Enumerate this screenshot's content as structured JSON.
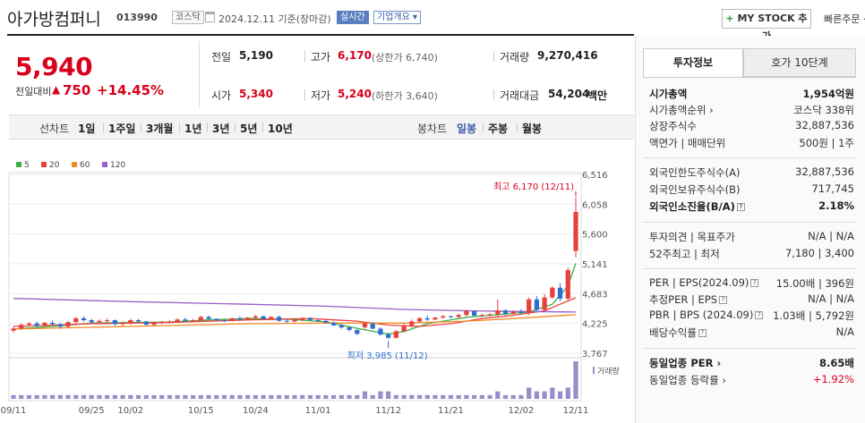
{
  "header": {
    "company_name": "아가방컴퍼니",
    "code": "013990",
    "market_tag": "코스닥",
    "date": "2024.12.11 기준(장마감)",
    "live_tag": "실시간",
    "info_tag": "기업개요 ▾",
    "mystock_label": "MY STOCK 추가",
    "mystock_plus": "+",
    "quick_order": "빠른주문 ·"
  },
  "quote": {
    "price": "5,940",
    "change_label": "전일대비",
    "change_arrow": "▲",
    "change_amount": "750",
    "change_pct": "+14.45%",
    "prev_label": "전일",
    "prev_value": "5,190",
    "high_label": "고가",
    "high_value": "6,170",
    "upper_limit": "(상한가 6,740)",
    "volume_label": "거래량",
    "volume_value": "9,270,416",
    "open_label": "시가",
    "open_value": "5,340",
    "low_label": "저가",
    "low_value": "5,240",
    "lower_limit": "(하한가 3,640)",
    "amount_label": "거래대금",
    "amount_value": "54,204",
    "amount_unit": "백만"
  },
  "period_bar": {
    "line_label": "선차트",
    "line_items": [
      "1일",
      "1주일",
      "3개월",
      "1년",
      "3년",
      "5년",
      "10년"
    ],
    "candle_label": "봉차트",
    "candle_items": [
      "일봉",
      "주봉",
      "월봉"
    ],
    "selected_candle": "일봉"
  },
  "chart_data": {
    "type": "candlestick",
    "legend": [
      {
        "name": "5",
        "color": "#3cb044"
      },
      {
        "name": "20",
        "color": "#e8413c"
      },
      {
        "name": "60",
        "color": "#f08a24"
      },
      {
        "name": "120",
        "color": "#9c5fc6"
      }
    ],
    "y_ticks": [
      3767,
      4225,
      4683,
      5141,
      5600,
      6058,
      6516
    ],
    "y_tick_labels": [
      "3,767",
      "4,225",
      "4,683",
      "5,141",
      "5,600",
      "6,058",
      "6,516"
    ],
    "ylim": [
      3767,
      6516
    ],
    "x_tick_labels": [
      "09/11",
      "09/25",
      "10/02",
      "10/15",
      "10/24",
      "11/01",
      "11/12",
      "11/21",
      "12/02",
      "12/11"
    ],
    "x_tick_index": [
      0,
      10,
      15,
      24,
      31,
      39,
      48,
      56,
      65,
      72
    ],
    "max_annotation": "최고 6,170 (12/11)",
    "min_annotation": "최저 3,985 (11/12)",
    "volume_label": "거래량",
    "up_color": "#e8413c",
    "down_color": "#2d6fd0",
    "candles": [
      [
        4115,
        4175,
        4085,
        4145
      ],
      [
        4145,
        4225,
        4125,
        4205
      ],
      [
        4205,
        4245,
        4185,
        4225
      ],
      [
        4225,
        4255,
        4165,
        4185
      ],
      [
        4185,
        4245,
        4175,
        4235
      ],
      [
        4235,
        4275,
        4195,
        4215
      ],
      [
        4215,
        4235,
        4145,
        4175
      ],
      [
        4175,
        4265,
        4165,
        4245
      ],
      [
        4245,
        4325,
        4225,
        4305
      ],
      [
        4305,
        4335,
        4255,
        4275
      ],
      [
        4275,
        4295,
        4225,
        4245
      ],
      [
        4245,
        4285,
        4215,
        4265
      ],
      [
        4265,
        4305,
        4235,
        4275
      ],
      [
        4275,
        4285,
        4195,
        4215
      ],
      [
        4215,
        4255,
        4185,
        4235
      ],
      [
        4235,
        4295,
        4205,
        4275
      ],
      [
        4275,
        4295,
        4235,
        4255
      ],
      [
        4255,
        4265,
        4195,
        4205
      ],
      [
        4205,
        4255,
        4185,
        4235
      ],
      [
        4235,
        4265,
        4215,
        4245
      ],
      [
        4245,
        4275,
        4225,
        4255
      ],
      [
        4255,
        4305,
        4235,
        4285
      ],
      [
        4285,
        4315,
        4245,
        4265
      ],
      [
        4265,
        4295,
        4245,
        4275
      ],
      [
        4275,
        4345,
        4255,
        4325
      ],
      [
        4325,
        4345,
        4285,
        4295
      ],
      [
        4295,
        4305,
        4255,
        4275
      ],
      [
        4275,
        4295,
        4245,
        4265
      ],
      [
        4265,
        4315,
        4255,
        4305
      ],
      [
        4305,
        4335,
        4265,
        4285
      ],
      [
        4285,
        4325,
        4275,
        4315
      ],
      [
        4315,
        4355,
        4295,
        4335
      ],
      [
        4335,
        4345,
        4285,
        4295
      ],
      [
        4295,
        4335,
        4285,
        4325
      ],
      [
        4325,
        4345,
        4255,
        4265
      ],
      [
        4265,
        4285,
        4235,
        4255
      ],
      [
        4255,
        4295,
        4245,
        4275
      ],
      [
        4275,
        4325,
        4265,
        4305
      ],
      [
        4305,
        4325,
        4265,
        4275
      ],
      [
        4275,
        4295,
        4245,
        4265
      ],
      [
        4265,
        4275,
        4225,
        4235
      ],
      [
        4235,
        4255,
        4185,
        4195
      ],
      [
        4195,
        4215,
        4145,
        4165
      ],
      [
        4165,
        4175,
        4105,
        4125
      ],
      [
        4125,
        4135,
        4045,
        4065
      ],
      [
        4165,
        4255,
        4145,
        4225
      ],
      [
        4225,
        4245,
        4135,
        4145
      ],
      [
        4145,
        4165,
        4035,
        4055
      ],
      [
        4055,
        4085,
        3985,
        4005
      ],
      [
        4005,
        4125,
        3995,
        4105
      ],
      [
        4105,
        4215,
        4085,
        4195
      ],
      [
        4195,
        4285,
        4165,
        4255
      ],
      [
        4255,
        4325,
        4235,
        4305
      ],
      [
        4305,
        4345,
        4265,
        4285
      ],
      [
        4285,
        4325,
        4275,
        4315
      ],
      [
        4315,
        4355,
        4295,
        4335
      ],
      [
        4335,
        4345,
        4305,
        4325
      ],
      [
        4325,
        4375,
        4305,
        4355
      ],
      [
        4355,
        4435,
        4335,
        4415
      ],
      [
        4415,
        4425,
        4335,
        4345
      ],
      [
        4345,
        4375,
        4325,
        4355
      ],
      [
        4355,
        4385,
        4335,
        4365
      ],
      [
        4365,
        4595,
        4335,
        4425
      ],
      [
        4425,
        4445,
        4345,
        4375
      ],
      [
        4375,
        4425,
        4345,
        4405
      ],
      [
        4405,
        4445,
        4365,
        4385
      ],
      [
        4385,
        4625,
        4355,
        4595
      ],
      [
        4595,
        4645,
        4415,
        4435
      ],
      [
        4435,
        4675,
        4415,
        4625
      ],
      [
        4625,
        4795,
        4605,
        4775
      ],
      [
        4775,
        4845,
        4565,
        4605
      ],
      [
        4605,
        5085,
        4585,
        5045
      ],
      [
        5340,
        6170,
        5240,
        5940
      ]
    ],
    "ma": {
      "5": [
        [
          0,
          4140
        ],
        [
          5,
          4180
        ],
        [
          10,
          4230
        ],
        [
          15,
          4240
        ],
        [
          20,
          4245
        ],
        [
          25,
          4280
        ],
        [
          30,
          4300
        ],
        [
          35,
          4290
        ],
        [
          40,
          4250
        ],
        [
          44,
          4150
        ],
        [
          48,
          4060
        ],
        [
          50,
          4100
        ],
        [
          53,
          4220
        ],
        [
          58,
          4320
        ],
        [
          62,
          4360
        ],
        [
          66,
          4400
        ],
        [
          69,
          4520
        ],
        [
          71,
          4800
        ],
        [
          72,
          5150
        ]
      ],
      "20": [
        [
          0,
          4180
        ],
        [
          10,
          4220
        ],
        [
          20,
          4240
        ],
        [
          30,
          4280
        ],
        [
          38,
          4300
        ],
        [
          44,
          4260
        ],
        [
          48,
          4200
        ],
        [
          52,
          4180
        ],
        [
          56,
          4220
        ],
        [
          60,
          4300
        ],
        [
          64,
          4350
        ],
        [
          68,
          4420
        ],
        [
          72,
          4620
        ]
      ],
      "60": [
        [
          0,
          4140
        ],
        [
          15,
          4180
        ],
        [
          30,
          4220
        ],
        [
          40,
          4230
        ],
        [
          50,
          4230
        ],
        [
          58,
          4260
        ],
        [
          64,
          4300
        ],
        [
          72,
          4360
        ]
      ],
      "120": [
        [
          0,
          4610
        ],
        [
          15,
          4560
        ],
        [
          30,
          4520
        ],
        [
          40,
          4490
        ],
        [
          50,
          4440
        ],
        [
          58,
          4420
        ],
        [
          64,
          4410
        ],
        [
          72,
          4400
        ]
      ]
    },
    "volume": [
      1,
      1,
      1,
      1,
      1,
      1,
      1,
      1,
      1,
      1,
      1,
      1,
      1,
      1,
      1,
      1,
      1,
      1,
      1,
      1,
      1,
      1,
      1,
      1,
      1,
      1,
      1,
      1,
      1,
      1,
      1,
      1,
      1,
      1,
      1,
      1,
      1,
      1,
      1,
      1,
      1,
      1,
      1,
      1,
      1,
      2,
      1,
      2,
      2,
      1,
      1,
      1,
      1,
      1,
      1,
      1,
      1,
      1,
      1,
      1,
      1,
      1,
      2,
      1,
      1,
      1,
      3,
      2,
      2,
      3,
      2,
      3,
      10
    ]
  },
  "right_panel": {
    "tab_active": "투자정보",
    "tab_other": "호가 10단계",
    "rows": [
      {
        "label": "시가총액",
        "value": "1,954억원",
        "bold": true
      },
      {
        "label": "시가총액순위 ›",
        "value": "코스닥 338위"
      },
      {
        "label": "상장주식수",
        "value": "32,887,536"
      },
      {
        "label": "액면가 | 매매단위",
        "value": "500원 | 1주"
      },
      {
        "label": "외국인한도주식수(A)",
        "value": "32,887,536"
      },
      {
        "label": "외국인보유주식수(B)",
        "value": "717,745"
      },
      {
        "label": "외국인소진율(B/A)",
        "value": "2.18%",
        "bold": true,
        "info": true
      },
      {
        "label": "투자의견 | 목표주가",
        "value": "N/A | N/A"
      },
      {
        "label": "52주최고 | 최저",
        "value": "7,180 | 3,400"
      },
      {
        "label": "PER | EPS(2024.09)",
        "value": "15.00배 | 396원",
        "info": true
      },
      {
        "label": "추정PER | EPS",
        "value": "N/A | N/A",
        "info": true
      },
      {
        "label": "PBR | BPS (2024.09)",
        "value": "1.03배 | 5,792원",
        "info": true
      },
      {
        "label": "배당수익률",
        "value": "N/A",
        "info": true
      },
      {
        "label": "동일업종 PER ›",
        "value": "8.65배",
        "bold": true
      },
      {
        "label": "동일업종 등락률 ›",
        "value": "+1.92%",
        "red": true
      }
    ],
    "info_glyph": "?"
  }
}
